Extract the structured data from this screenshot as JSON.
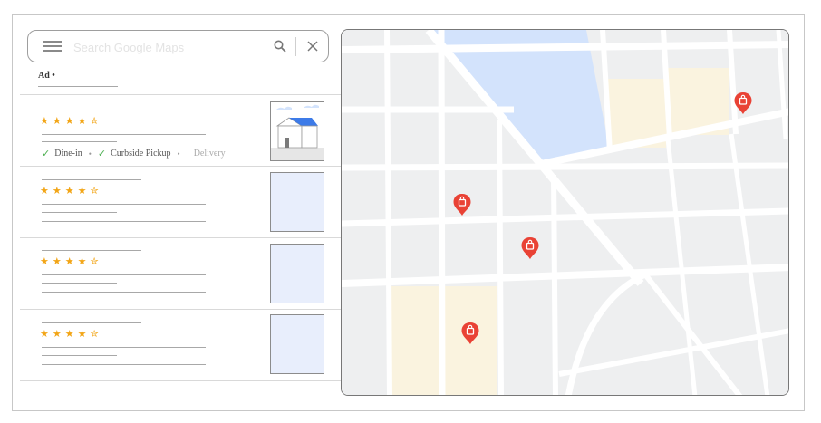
{
  "search": {
    "placeholder": "Search Google Maps"
  },
  "results": {
    "ad_label": "Ad •",
    "listings": [
      {
        "stars": "★★★★✮",
        "sponsored": true,
        "amenities": [
          "Dine-in",
          "Curbside Pickup",
          "Delivery"
        ]
      },
      {
        "stars": "★★★★✮"
      },
      {
        "stars": "★★★★✮"
      },
      {
        "stars": "★★★★✮"
      }
    ]
  },
  "icons": {
    "menu": "hamburger-menu-icon",
    "search": "search-icon",
    "close": "close-icon",
    "check": "checkmark-icon",
    "pin": "shopping-bag-location-pin-icon"
  },
  "colors": {
    "star": "#f2a516",
    "pin": "#e94235",
    "check": "#4caf50",
    "park": "#d3e3fc",
    "highlight_block": "#faf3df",
    "map_bg": "#eeeff0",
    "roof": "#3d7be8"
  }
}
